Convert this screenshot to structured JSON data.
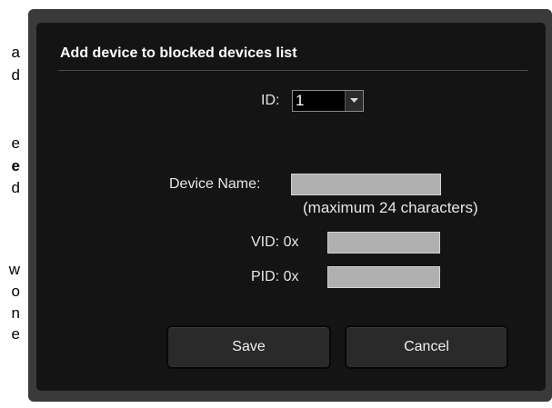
{
  "background_text": {
    "fragments": [
      "a",
      "d",
      "e",
      "e",
      "d",
      "w",
      "o",
      "n",
      "e"
    ]
  },
  "dialog": {
    "title": "Add device to blocked devices list",
    "id_label": "ID:",
    "id_value": "1",
    "device_name_label": "Device Name:",
    "device_name_value": "",
    "device_name_hint": "(maximum 24 characters)",
    "vid_label": "VID: 0x",
    "vid_value": "",
    "pid_label": "PID: 0x",
    "pid_value": "",
    "save_label": "Save",
    "cancel_label": "Cancel"
  },
  "icons": {
    "dropdown": "chevron-down-icon"
  },
  "colors": {
    "dialog_background": "#141414",
    "dialog_frame": "#3a3a3a",
    "field_fill": "#b0b0b0",
    "button_fill": "#2a2a2a",
    "text": "#e6e6e6"
  }
}
